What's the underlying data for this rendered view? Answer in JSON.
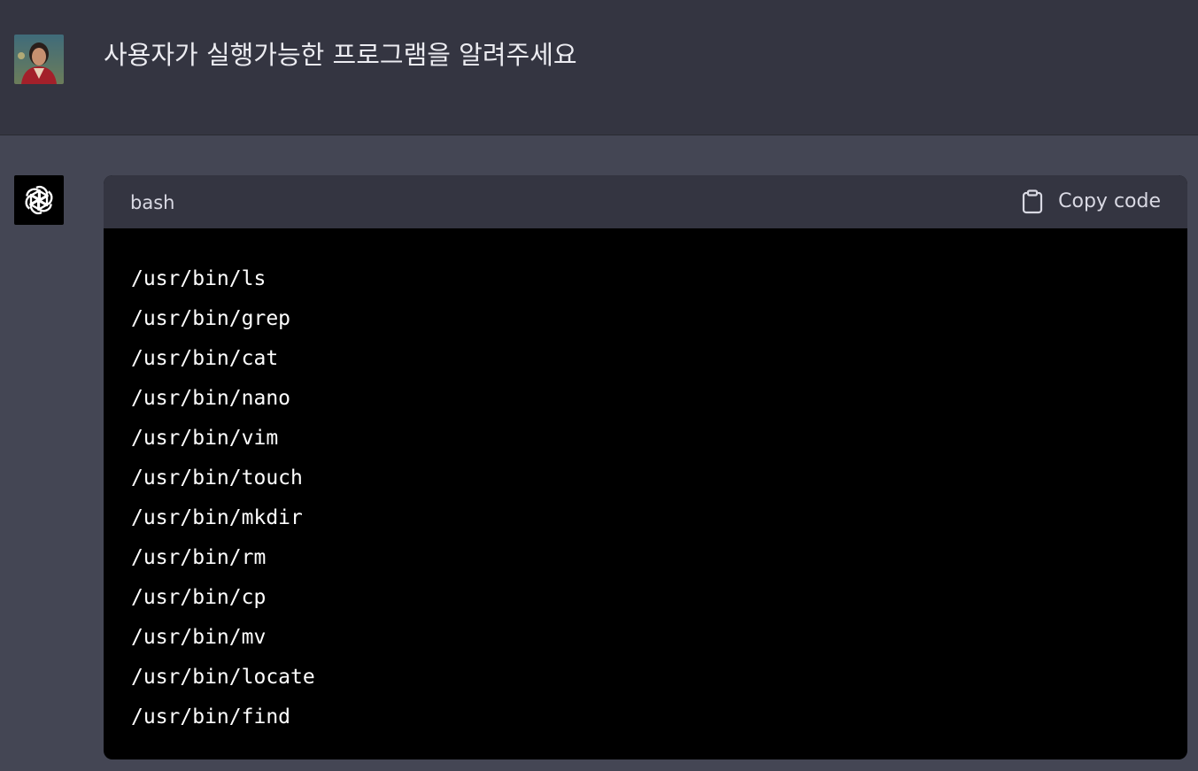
{
  "user_message": {
    "text": "사용자가 실행가능한 프로그램을 알려주세요"
  },
  "assistant": {
    "code_block": {
      "language": "bash",
      "copy_label": "Copy code",
      "lines": [
        "/usr/bin/ls",
        "/usr/bin/grep",
        "/usr/bin/cat",
        "/usr/bin/nano",
        "/usr/bin/vim",
        "/usr/bin/touch",
        "/usr/bin/mkdir",
        "/usr/bin/rm",
        "/usr/bin/cp",
        "/usr/bin/mv",
        "/usr/bin/locate",
        "/usr/bin/find"
      ]
    }
  },
  "icons": {
    "user_avatar": "user-avatar-photo",
    "assistant_avatar": "openai-logo-icon",
    "copy": "clipboard-icon"
  },
  "colors": {
    "user_row_bg": "#343541",
    "assistant_row_bg": "#444654",
    "code_header_bg": "#343541",
    "code_body_bg": "#000000"
  }
}
